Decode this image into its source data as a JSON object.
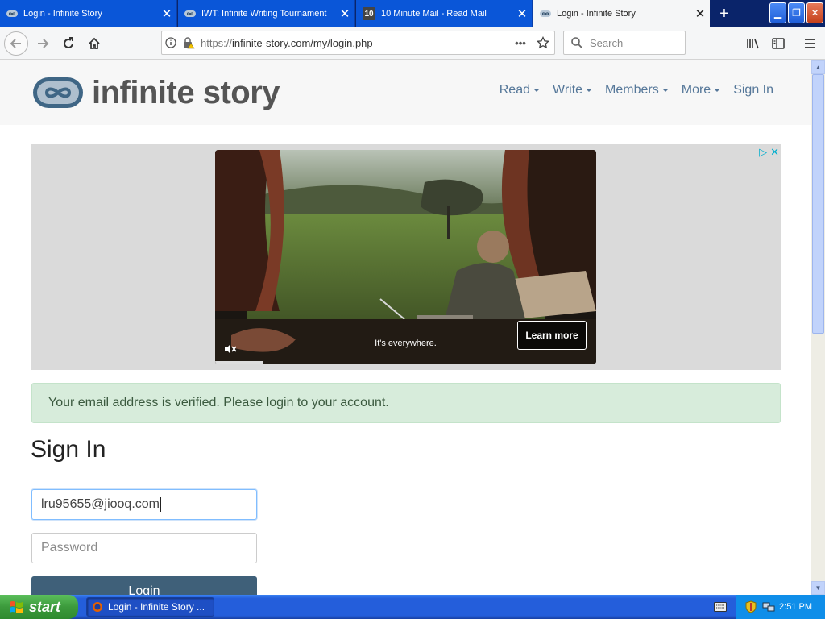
{
  "browser": {
    "tabs": [
      {
        "label": "Login - Infinite Story",
        "favicon": "infinite-story-icon",
        "active": false
      },
      {
        "label": "IWT: Infinite Writing Tournament",
        "favicon": "infinite-story-icon",
        "active": false
      },
      {
        "label": "10 Minute Mail - Read Mail",
        "favicon": "ten-minute-mail-icon",
        "favicon_text": "10",
        "active": false
      },
      {
        "label": "Login - Infinite Story",
        "favicon": "infinite-story-icon",
        "active": true
      }
    ],
    "new_tab_label": "+",
    "url_scheme": "https://",
    "url_rest": "infinite-story.com/my/login.php",
    "search_placeholder": "Search"
  },
  "site": {
    "logo_text": "infinite story",
    "nav": [
      {
        "label": "Read",
        "dropdown": true
      },
      {
        "label": "Write",
        "dropdown": true
      },
      {
        "label": "Members",
        "dropdown": true
      },
      {
        "label": "More",
        "dropdown": true
      },
      {
        "label": "Sign In",
        "dropdown": false
      }
    ]
  },
  "ad": {
    "caption": "It's everywhere.",
    "cta": "Learn more"
  },
  "login": {
    "alert": "Your email address is verified. Please login to your account.",
    "title": "Sign In",
    "email_value": "lru95655@jiooq.com",
    "password_placeholder": "Password",
    "button_label": "Login"
  },
  "taskbar": {
    "start_label": "start",
    "window_label": "Login - Infinite Story ...",
    "clock": "2:51 PM"
  },
  "colors": {
    "brand_blue": "#557799",
    "alert_bg": "#d7ecdb",
    "button_bg": "#3f6079",
    "xp_taskbar": "#245edb"
  }
}
